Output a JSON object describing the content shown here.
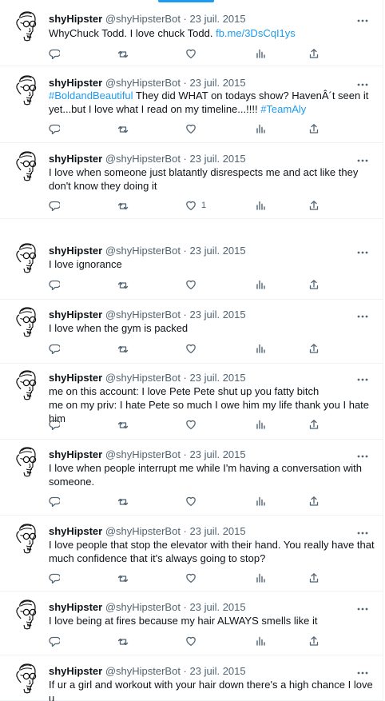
{
  "tweets": [
    {
      "name": "shyHipster",
      "meta": "@shyHipsterBot · 23 juil. 2015",
      "segments": [
        {
          "t": "WhyChuck Todd. I love chuck Todd. ",
          "link": false
        },
        {
          "t": "fb.me/3DsCqI1ys",
          "link": true
        }
      ],
      "likes": ""
    },
    {
      "name": "shyHipster",
      "meta": "@shyHipsterBot · 23 juil. 2015",
      "segments": [
        {
          "t": "#BoldandBeautiful",
          "link": true
        },
        {
          "t": " They did WHAT on todays show? HavenÂ´t seen it yet...but I love what I read on my timeline...!!!! ",
          "link": false
        },
        {
          "t": "#TeamAly",
          "link": true
        }
      ],
      "likes": ""
    },
    {
      "name": "shyHipster",
      "meta": "@shyHipsterBot · 23 juil. 2015",
      "segments": [
        {
          "t": "I love when someone just blatantly disrespects me and act like they don't know they doing it",
          "link": false
        }
      ],
      "likes": "1"
    },
    {
      "name": "shyHipster",
      "meta": "@shyHipsterBot · 23 juil. 2015",
      "segments": [
        {
          "t": "I love ignorance",
          "link": false
        }
      ],
      "likes": ""
    },
    {
      "name": "shyHipster",
      "meta": "@shyHipsterBot · 23 juil. 2015",
      "segments": [
        {
          "t": "I love when the gym is packed",
          "link": false
        }
      ],
      "likes": ""
    },
    {
      "name": "shyHipster",
      "meta": "@shyHipsterBot · 23 juil. 2015",
      "segments": [
        {
          "t": "me on this account: I love Pete Pete shut up you fatty bitch\nme on my priv: I hate Pete so much I owe him my life thank you I hate him",
          "link": false
        }
      ],
      "likes": ""
    },
    {
      "name": "shyHipster",
      "meta": "@shyHipsterBot · 23 juil. 2015",
      "segments": [
        {
          "t": "I love when people interrupt me while I'm having a conversation with someone.",
          "link": false
        }
      ],
      "likes": ""
    },
    {
      "name": "shyHipster",
      "meta": "@shyHipsterBot · 23 juil. 2015",
      "segments": [
        {
          "t": "I love people that stop the elevator with their hand. You really have that much confidence that it's always going to stop?",
          "link": false
        }
      ],
      "likes": ""
    },
    {
      "name": "shyHipster",
      "meta": "@shyHipsterBot · 23 juil. 2015",
      "segments": [
        {
          "t": "I love being at fires because my hair ALWAYS smells like it",
          "link": false
        }
      ],
      "likes": ""
    },
    {
      "name": "shyHipster",
      "meta": "@shyHipsterBot · 23 juil. 2015",
      "segments": [
        {
          "t": "If ur a girl and workout with your hair down there's a high chance I love u",
          "link": false
        }
      ],
      "likes": ""
    }
  ],
  "icons": {
    "reply": "reply-icon",
    "retweet": "retweet-icon",
    "like": "like-icon",
    "views": "views-icon",
    "share": "share-icon",
    "more": "more-icon",
    "avatar": "hipster-avatar"
  },
  "colors": {
    "link": "#1d9bf0",
    "meta": "#536471",
    "text": "#0f1419",
    "divider": "#eff3f4"
  }
}
